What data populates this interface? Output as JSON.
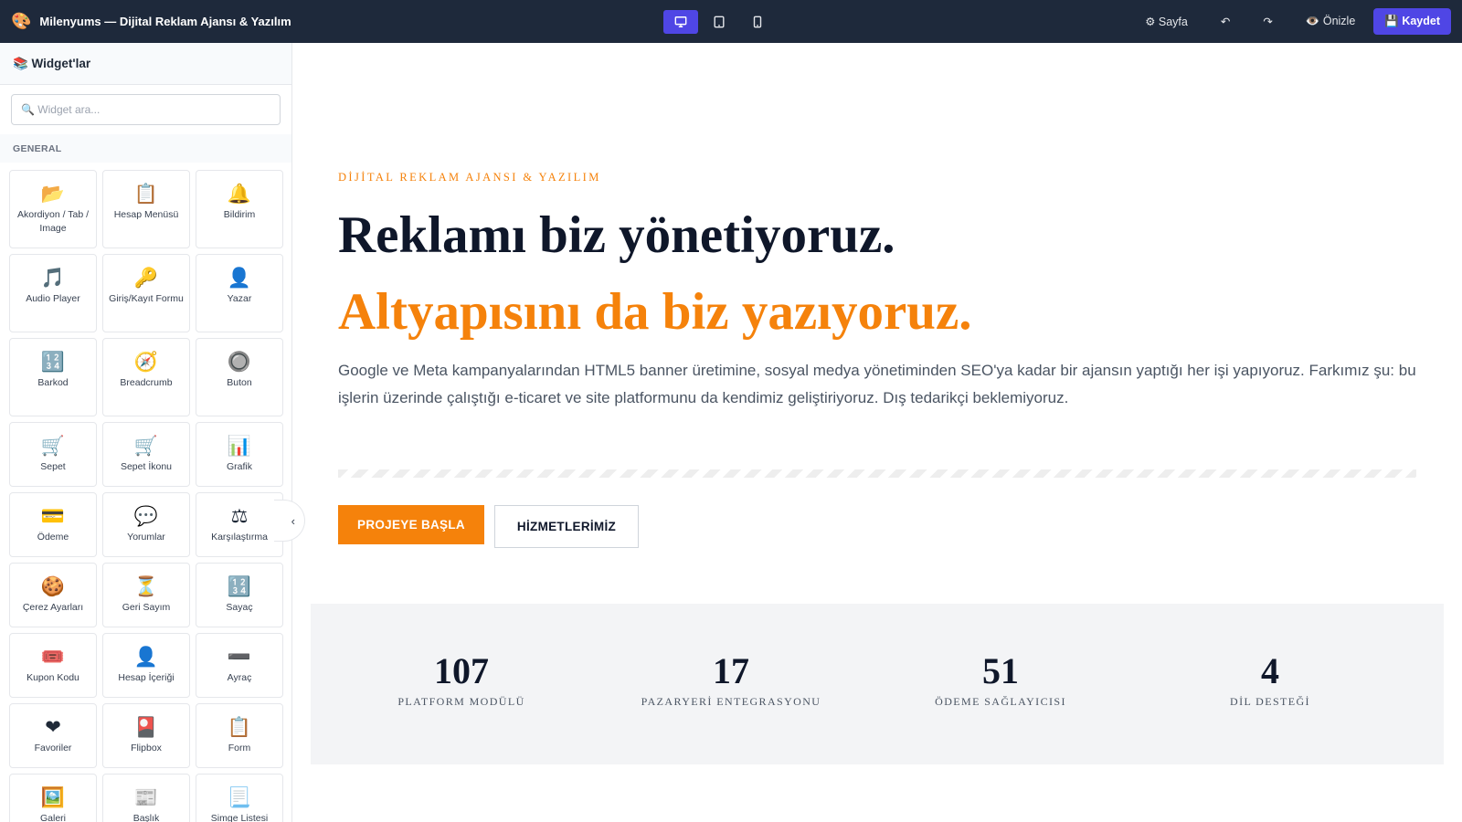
{
  "topbar": {
    "logo_icon": "🎨",
    "title": "Milenyums — Dijital Reklam Ajansı & Yazılım",
    "devices": [
      {
        "name": "desktop",
        "active": true
      },
      {
        "name": "tablet",
        "active": false
      },
      {
        "name": "mobile",
        "active": false
      }
    ],
    "page_label": "⚙ Sayfa",
    "undo_label": "↶",
    "redo_label": "↷",
    "preview_label": "👁️ Önizle",
    "save_label": "💾 Kaydet",
    "colors": {
      "bar": "#1e293b",
      "accent": "#4f46e5"
    }
  },
  "sidebar": {
    "header": "📚 Widget'lar",
    "search_placeholder": "🔍 Widget ara...",
    "category": "GENERAL",
    "collapse_icon": "‹",
    "widgets": [
      {
        "icon": "📂",
        "label": "Akordiyon / Tab / Image"
      },
      {
        "icon": "📋",
        "label": "Hesap Menüsü"
      },
      {
        "icon": "🔔",
        "label": "Bildirim"
      },
      {
        "icon": "🎵",
        "label": "Audio Player"
      },
      {
        "icon": "🔑",
        "label": "Giriş/Kayıt Formu"
      },
      {
        "icon": "👤",
        "label": "Yazar"
      },
      {
        "icon": "🔢",
        "label": "Barkod"
      },
      {
        "icon": "🧭",
        "label": "Breadcrumb"
      },
      {
        "icon": "🔘",
        "label": "Buton"
      },
      {
        "icon": "🛒",
        "label": "Sepet"
      },
      {
        "icon": "🛒",
        "label": "Sepet İkonu"
      },
      {
        "icon": "📊",
        "label": "Grafik"
      },
      {
        "icon": "💳",
        "label": "Ödeme"
      },
      {
        "icon": "💬",
        "label": "Yorumlar"
      },
      {
        "icon": "⚖",
        "label": "Karşılaştırma"
      },
      {
        "icon": "🍪",
        "label": "Çerez Ayarları"
      },
      {
        "icon": "⏳",
        "label": "Geri Sayım"
      },
      {
        "icon": "🔢",
        "label": "Sayaç"
      },
      {
        "icon": "🎟️",
        "label": "Kupon Kodu"
      },
      {
        "icon": "👤",
        "label": "Hesap İçeriği"
      },
      {
        "icon": "➖",
        "label": "Ayraç"
      },
      {
        "icon": "❤",
        "label": "Favoriler"
      },
      {
        "icon": "🎴",
        "label": "Flipbox"
      },
      {
        "icon": "📋",
        "label": "Form"
      },
      {
        "icon": "🖼️",
        "label": "Galeri"
      },
      {
        "icon": "📰",
        "label": "Başlık"
      },
      {
        "icon": "📃",
        "label": "Simge Listesi"
      }
    ]
  },
  "hero": {
    "eyebrow": "DİJİTAL REKLAM AJANSI & YAZILIM",
    "title_line1": "Reklamı biz yönetiyoruz.",
    "title_line2": "Altyapısını da biz yazıyoruz.",
    "description": "Google ve Meta kampanyalarından HTML5 banner üretimine, sosyal medya yönetiminden SEO'ya kadar bir ajansın yaptığı her işi yapıyoruz. Farkımız şu: bu işlerin üzerinde çalıştığı e-ticaret ve site platformunu da kendimiz geliştiriyoruz. Dış tedarikçi beklemiyoruz.",
    "primary_button": "PROJEYE BAŞLA",
    "secondary_button": "HİZMETLERİMİZ",
    "colors": {
      "accent": "#f5820b",
      "heading": "#0f172a"
    }
  },
  "stats": [
    {
      "value": "107",
      "label": "PLATFORM MODÜLÜ"
    },
    {
      "value": "17",
      "label": "PAZARYERİ ENTEGRASYONU"
    },
    {
      "value": "51",
      "label": "ÖDEME SAĞLAYICISI"
    },
    {
      "value": "4",
      "label": "DİL DESTEĞİ"
    }
  ]
}
